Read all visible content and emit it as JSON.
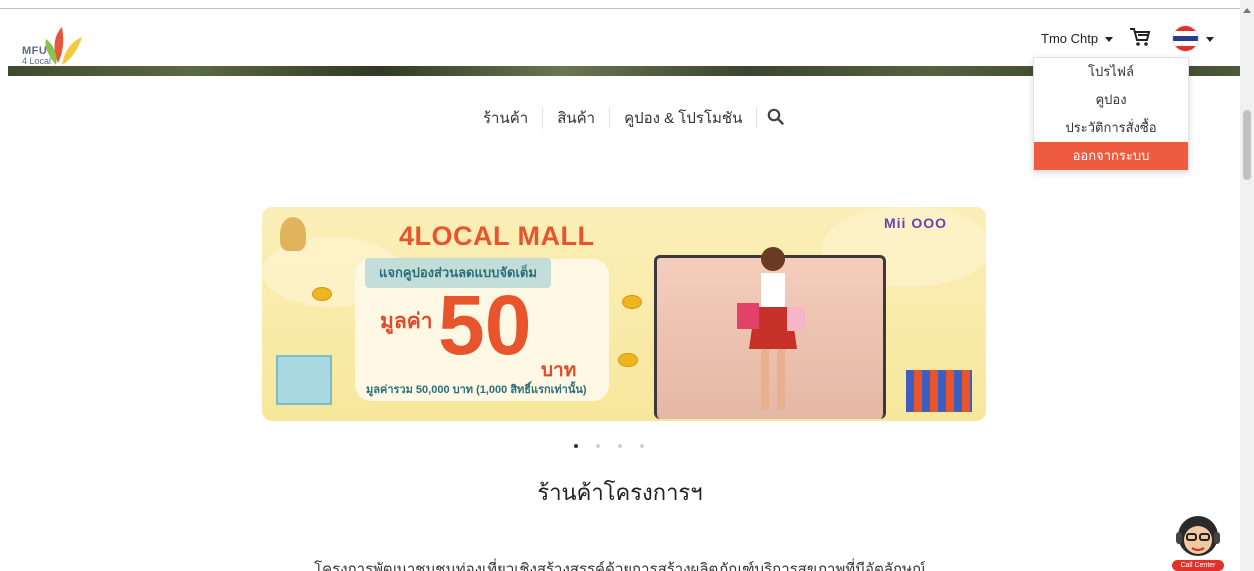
{
  "header": {
    "logo_line1": "MFU",
    "logo_line2": "4 Local",
    "user_name": "Tmo Chtp",
    "cart_icon": "cart-icon",
    "language_flag": "thailand-flag-icon"
  },
  "user_dropdown": {
    "items": [
      {
        "label": "โปรไฟล์"
      },
      {
        "label": "คูปอง"
      },
      {
        "label": "ประวัติการสั่งซื้อ"
      },
      {
        "label": "ออกจากระบบ"
      }
    ],
    "logout_color": "#ef5b3e"
  },
  "nav": {
    "items": [
      {
        "label": "ร้านค้า"
      },
      {
        "label": "สินค้า"
      },
      {
        "label": "คูปอง & โปรโมชัน"
      }
    ],
    "search_icon": "search-icon"
  },
  "banner": {
    "brand": "4LOCAL MALL",
    "tagline": "แจกคูปองส่วนลดแบบจัดเต็ม",
    "value_label": "มูลค่า",
    "value_amount": "50",
    "value_unit": "บาท",
    "fine_print": "มูลค่ารวม 50,000 บาท (1,000 สิทธิ์แรกเท่านั้น)",
    "partners": "Mii OOO",
    "brand_color": "#e8552d"
  },
  "carousel": {
    "total_slides": 4,
    "active_slide": 1
  },
  "main": {
    "section_title": "ร้านค้าโครงการฯ",
    "description": "โครงการพัฒนาชุมชนท่องเที่ยวเชิงสร้างสรรค์ด้วยการสร้างผลิตภัณฑ์บริการสุขภาพที่มีอัตลักษณ์"
  },
  "call_center": {
    "label": "Call Center"
  }
}
